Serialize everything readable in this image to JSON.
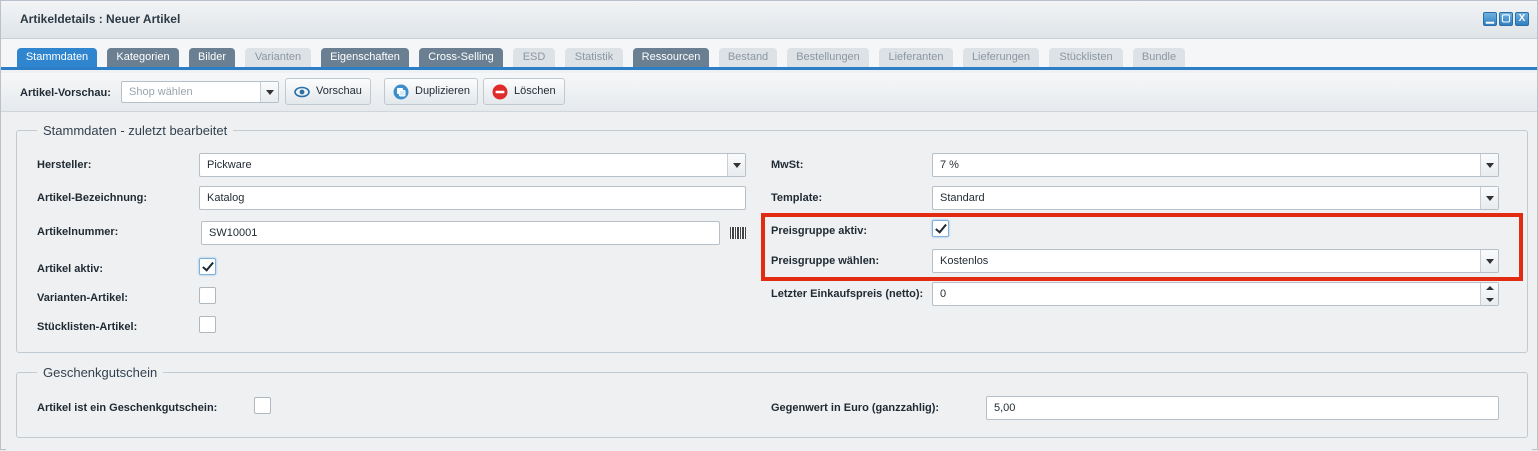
{
  "window": {
    "title": "Artikeldetails : Neuer Artikel",
    "buttons": [
      "minimize",
      "maximize",
      "close"
    ],
    "close_glyph": "X"
  },
  "tabs": [
    {
      "label": "Stammdaten",
      "state": "active"
    },
    {
      "label": "Kategorien",
      "state": "enabled"
    },
    {
      "label": "Bilder",
      "state": "enabled"
    },
    {
      "label": "Varianten",
      "state": "disabled"
    },
    {
      "label": "Eigenschaften",
      "state": "enabled"
    },
    {
      "label": "Cross-Selling",
      "state": "enabled"
    },
    {
      "label": "ESD",
      "state": "disabled"
    },
    {
      "label": "Statistik",
      "state": "disabled"
    },
    {
      "label": "Ressourcen",
      "state": "enabled"
    },
    {
      "label": "Bestand",
      "state": "disabled"
    },
    {
      "label": "Bestellungen",
      "state": "disabled"
    },
    {
      "label": "Lieferanten",
      "state": "disabled"
    },
    {
      "label": "Lieferungen",
      "state": "disabled"
    },
    {
      "label": "Stücklisten",
      "state": "disabled"
    },
    {
      "label": "Bundle",
      "state": "disabled"
    }
  ],
  "toolbar": {
    "preview_label": "Artikel-Vorschau:",
    "shop_placeholder": "Shop wählen",
    "preview_button": "Vorschau",
    "duplicate_button": "Duplizieren",
    "delete_button": "Löschen"
  },
  "stammdaten": {
    "legend": "Stammdaten - zuletzt bearbeitet",
    "hersteller_label": "Hersteller:",
    "hersteller_value": "Pickware",
    "bezeichnung_label": "Artikel-Bezeichnung:",
    "bezeichnung_value": "Katalog",
    "artikelnummer_label": "Artikelnummer:",
    "artikelnummer_value": "SW10001",
    "aktiv_label": "Artikel aktiv:",
    "aktiv_checked": true,
    "varianten_label": "Varianten-Artikel:",
    "varianten_checked": false,
    "stueckliste_label": "Stücklisten-Artikel:",
    "stueckliste_checked": false,
    "mwst_label": "MwSt:",
    "mwst_value": "7 %",
    "template_label": "Template:",
    "template_value": "Standard",
    "preisgruppe_aktiv_label": "Preisgruppe aktiv:",
    "preisgruppe_aktiv_checked": true,
    "preisgruppe_waehlen_label": "Preisgruppe wählen:",
    "preisgruppe_waehlen_value": "Kostenlos",
    "einkaufspreis_label": "Letzter Einkaufspreis (netto):",
    "einkaufspreis_value": "0"
  },
  "geschenkgutschein": {
    "legend": "Geschenkgutschein",
    "is_voucher_label": "Artikel ist ein Geschenkgutschein:",
    "is_voucher_checked": false,
    "gegenwert_label": "Gegenwert in Euro (ganzzahlig):",
    "gegenwert_value": "5,00"
  },
  "colors": {
    "accent": "#2f86cf",
    "highlight_box": "#e32b12"
  }
}
